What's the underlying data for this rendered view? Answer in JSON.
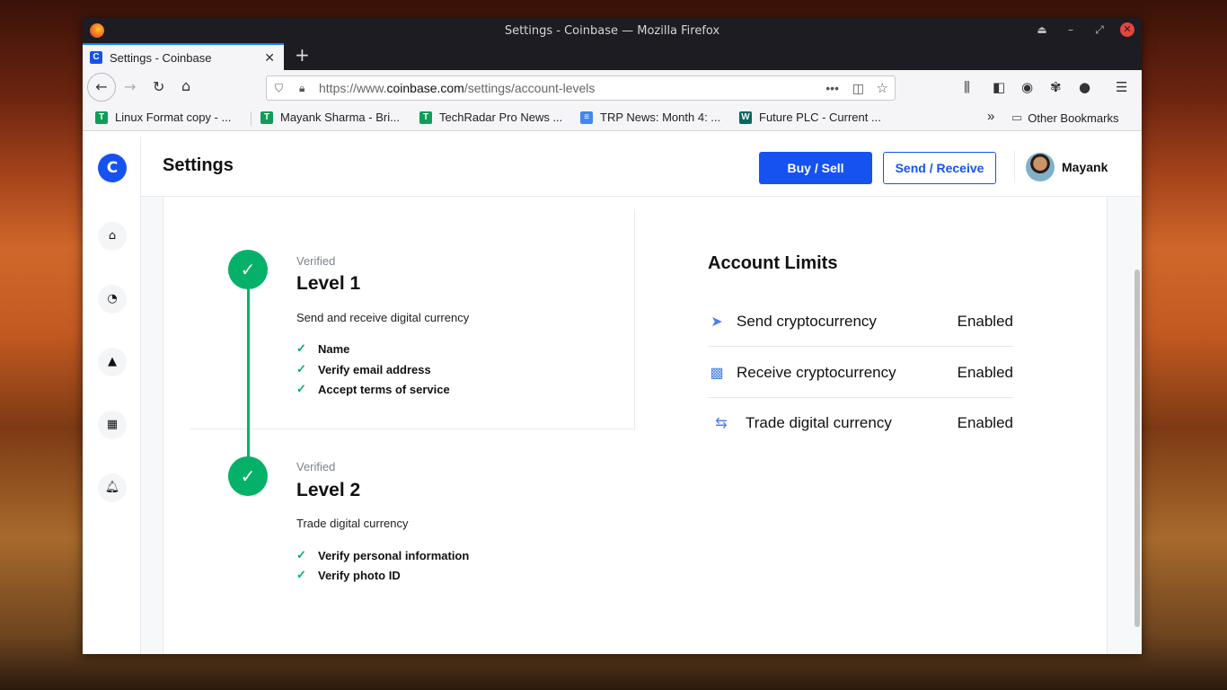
{
  "window": {
    "title": "Settings - Coinbase — Mozilla Firefox"
  },
  "tabs": [
    {
      "label": "Settings - Coinbase"
    }
  ],
  "navbar": {
    "url_prefix": "https://www.",
    "url_host": "coinbase.com",
    "url_path": "/settings/account-levels"
  },
  "bookmarks": [
    {
      "label": "Linux Format copy - ...",
      "color": "#0f9d58",
      "glyph": "T"
    },
    {
      "label": "Mayank Sharma - Bri...",
      "color": "#0f9d58",
      "glyph": "T"
    },
    {
      "label": "TechRadar Pro News ...",
      "color": "#0f9d58",
      "glyph": "T"
    },
    {
      "label": "TRP News: Month 4: ...",
      "color": "#4285f4",
      "glyph": "≡"
    },
    {
      "label": "Future PLC - Current ...",
      "color": "#00695c",
      "glyph": "W"
    }
  ],
  "bookmarks_other": "Other Bookmarks",
  "header": {
    "title": "Settings",
    "buy_sell": "Buy / Sell",
    "send_receive": "Send / Receive",
    "user_name": "Mayank"
  },
  "levels": [
    {
      "status": "Verified",
      "title": "Level 1",
      "description": "Send and receive digital currency",
      "requirements": [
        "Name",
        "Verify email address",
        "Accept terms of service"
      ]
    },
    {
      "status": "Verified",
      "title": "Level 2",
      "description": "Trade digital currency",
      "requirements": [
        "Verify personal information",
        "Verify photo ID"
      ]
    }
  ],
  "limits": {
    "title": "Account Limits",
    "rows": [
      {
        "label": "Send cryptocurrency",
        "status": "Enabled",
        "icon": "send-icon"
      },
      {
        "label": "Receive cryptocurrency",
        "status": "Enabled",
        "icon": "qr-code-icon"
      },
      {
        "label": "Trade digital currency",
        "status": "Enabled",
        "icon": "trade-icon"
      }
    ]
  },
  "colors": {
    "brand": "#1652f0",
    "success": "#05b169"
  }
}
